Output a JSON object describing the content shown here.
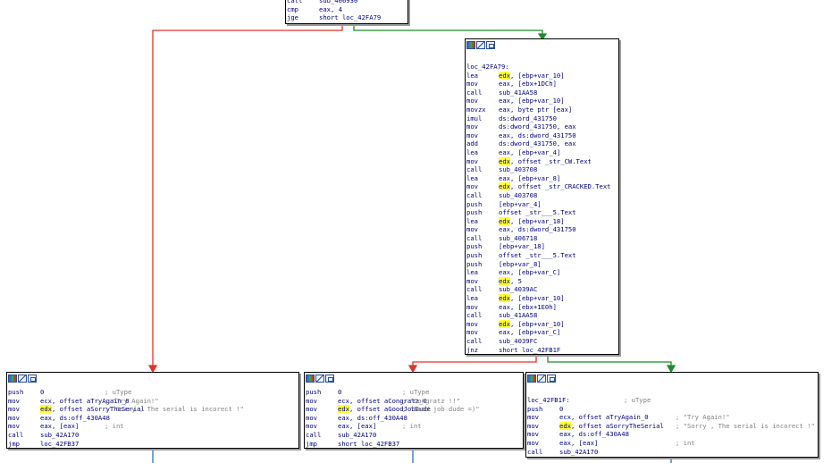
{
  "colors": {
    "edge_false": "#e0332c",
    "edge_true": "#1e8c28",
    "edge_flow": "#4a7fd0",
    "node_border": "#000000",
    "highlight": "#ffff33",
    "code_text": "#000080"
  },
  "icons": [
    "node-color-icon",
    "graph-overview-icon",
    "xrefs-icon"
  ],
  "top_block": {
    "lines": [
      {
        "m": "call",
        "ops": "sub_406930"
      },
      {
        "m": "cmp",
        "ops": "eax, 4"
      },
      {
        "m": "jge",
        "ops": "short loc_42FA79"
      }
    ]
  },
  "main_block": {
    "label": "loc_42FA79:",
    "lines": [
      {
        "m": "lea",
        "hl": "edx",
        "ops": ", [ebp+var_10]"
      },
      {
        "m": "mov",
        "ops": "eax, [ebx+1DCh]"
      },
      {
        "m": "call",
        "ops": "sub_41AA58"
      },
      {
        "m": "mov",
        "ops": "eax, [ebp+var_10]"
      },
      {
        "m": "movzx",
        "ops": "eax, byte ptr [eax]"
      },
      {
        "m": "imul",
        "ops": "ds:dword_431750"
      },
      {
        "m": "mov",
        "ops": "ds:dword_431750, eax"
      },
      {
        "m": "mov",
        "ops": "eax, ds:dword_431750"
      },
      {
        "m": "add",
        "ops": "ds:dword_431750, eax"
      },
      {
        "m": "lea",
        "ops": "eax, [ebp+var_4]"
      },
      {
        "m": "mov",
        "hl": "edx",
        "ops": ", offset _str_CW.Text"
      },
      {
        "m": "call",
        "ops": "sub_403708"
      },
      {
        "m": "lea",
        "ops": "eax, [ebp+var_8]"
      },
      {
        "m": "mov",
        "hl": "edx",
        "ops": ", offset _str_CRACKED.Text"
      },
      {
        "m": "call",
        "ops": "sub_403708"
      },
      {
        "m": "push",
        "ops": "[ebp+var_4]"
      },
      {
        "m": "push",
        "ops": "offset _str___5.Text"
      },
      {
        "m": "lea",
        "hl": "edx",
        "ops": ", [ebp+var_18]"
      },
      {
        "m": "mov",
        "ops": "eax, ds:dword_431750"
      },
      {
        "m": "call",
        "ops": "sub_406718"
      },
      {
        "m": "push",
        "ops": "[ebp+var_18]"
      },
      {
        "m": "push",
        "ops": "offset _str___5.Text"
      },
      {
        "m": "push",
        "ops": "[ebp+var_8]"
      },
      {
        "m": "lea",
        "ops": "eax, [ebp+var_C]"
      },
      {
        "m": "mov",
        "hl": "edx",
        "ops": ", 5"
      },
      {
        "m": "call",
        "ops": "sub_4039AC"
      },
      {
        "m": "lea",
        "hl": "edx",
        "ops": ", [ebp+var_10]"
      },
      {
        "m": "mov",
        "ops": "eax, [ebx+1E0h]"
      },
      {
        "m": "call",
        "ops": "sub_41AA58"
      },
      {
        "m": "mov",
        "hl": "edx",
        "ops": ", [ebp+var_10]"
      },
      {
        "m": "mov",
        "ops": "eax, [ebp+var_C]"
      },
      {
        "m": "call",
        "ops": "sub_4039FC"
      },
      {
        "m": "jnz",
        "ops": "short loc_42FB1F"
      }
    ]
  },
  "left_block": {
    "lines": [
      {
        "m": "push",
        "ops": "0",
        "cm": "; uType"
      },
      {
        "m": "mov",
        "ops": "ecx, offset aTryAgain_0",
        "cm": "; \"Try Again!\""
      },
      {
        "m": "mov",
        "hl": "edx",
        "ops": ", offset aSorryTheSerial",
        "cm": "; \"Sorry , The serial is incorect !\""
      },
      {
        "m": "mov",
        "ops": "eax, ds:off_430A48"
      },
      {
        "m": "mov",
        "ops": "eax, [eax]",
        "cm": "; int"
      },
      {
        "m": "call",
        "ops": "sub_42A170"
      },
      {
        "m": "jmp",
        "ops": "loc_42FB37"
      }
    ]
  },
  "middle_block": {
    "lines": [
      {
        "m": "push",
        "ops": "0",
        "cm": "; uType"
      },
      {
        "m": "mov",
        "ops": "ecx, offset aCongratz_0",
        "cm": "; \"Congratz !!\""
      },
      {
        "m": "mov",
        "hl": "edx",
        "ops": ", offset aGoodJobDude",
        "cm": "; \"Good job dude =)\""
      },
      {
        "m": "mov",
        "ops": "eax, ds:off_430A48"
      },
      {
        "m": "mov",
        "ops": "eax, [eax]",
        "cm": "; int"
      },
      {
        "m": "call",
        "ops": "sub_42A170"
      },
      {
        "m": "jmp",
        "ops": "short loc_42FB37"
      }
    ]
  },
  "right_block": {
    "label": "loc_42FB1F:",
    "label_cm": "; uType",
    "lines": [
      {
        "m": "push",
        "ops": "0"
      },
      {
        "m": "mov",
        "ops": "ecx, offset aTryAgain_0",
        "cm": "; \"Try Again!\""
      },
      {
        "m": "mov",
        "hl": "edx",
        "ops": ", offset aSorryTheSerial",
        "cm": "; \"Sorry , The serial is incorect !\""
      },
      {
        "m": "mov",
        "ops": "eax, ds:off_430A48"
      },
      {
        "m": "mov",
        "ops": "eax, [eax]",
        "cm": "; int"
      },
      {
        "m": "call",
        "ops": "sub_42A170"
      }
    ]
  }
}
